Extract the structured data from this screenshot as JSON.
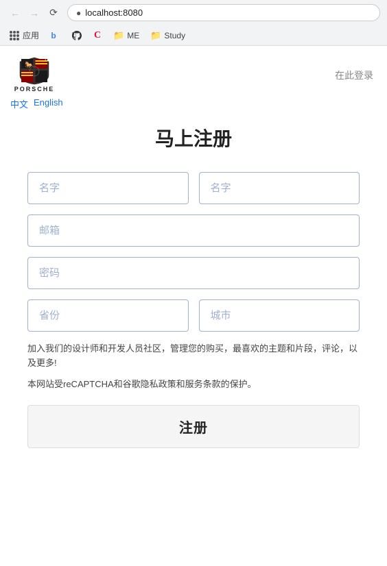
{
  "browser": {
    "url": "localhost:8080",
    "back_disabled": true,
    "forward_disabled": true,
    "bookmarks": [
      {
        "id": "apps",
        "label": "应用"
      },
      {
        "id": "b",
        "label": "",
        "icon": "b-icon"
      },
      {
        "id": "github",
        "label": "",
        "icon": "github-icon"
      },
      {
        "id": "crimson",
        "label": "",
        "icon": "c-icon"
      },
      {
        "id": "me",
        "label": "ME",
        "icon": "folder-icon"
      },
      {
        "id": "study",
        "label": "Study",
        "icon": "folder-icon"
      }
    ]
  },
  "header": {
    "login_label": "在此登录",
    "porsche_wordmark": "PORSCHE"
  },
  "language": {
    "chinese_label": "中文",
    "english_label": "English"
  },
  "form": {
    "title": "马上注册",
    "first_name_placeholder": "名字",
    "last_name_placeholder": "名字",
    "email_placeholder": "邮箱",
    "password_placeholder": "密码",
    "province_placeholder": "省份",
    "city_placeholder": "城市",
    "description": "加入我们的设计师和开发人员社区，管理您的购买，最喜欢的主题和片段，评论，以及更多!",
    "recaptcha_text": "本网站受reCAPTCHA和谷歌隐私政策和服务条款的保护。",
    "submit_label": "注册"
  }
}
